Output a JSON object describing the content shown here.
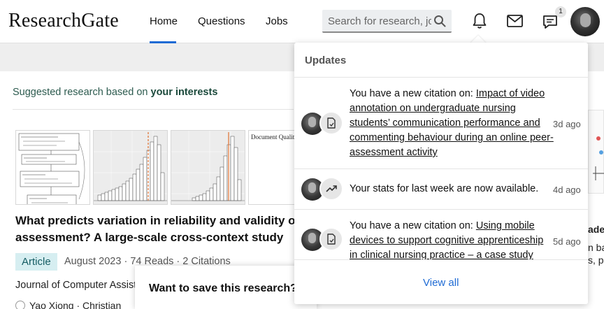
{
  "header": {
    "logo": "ResearchGate",
    "nav": {
      "home": "Home",
      "questions": "Questions",
      "jobs": "Jobs"
    },
    "search_placeholder": "Search for research, jobs",
    "messages_badge": "1",
    "accent_color": "#1f6bd4"
  },
  "main": {
    "suggested_prefix": "Suggested research based on ",
    "suggested_bold": "your interests",
    "thumb_doc_text": "Document Quality",
    "paper": {
      "title_line1": "What predicts variation in reliability and validity of online peer",
      "title_line2": "assessment? A large-scale cross-context study",
      "type": "Article",
      "meta": "August 2023 · 74 Reads · 2 Citations",
      "journal": "Journal of Computer Assisted Learning",
      "authors": "Yao Xiong · Christian"
    },
    "save_prompt": "Want to save this research?",
    "right_partial": {
      "line1": "ader",
      "line2": "n ba",
      "line3": "s, p"
    }
  },
  "updates": {
    "title": "Updates",
    "items": [
      {
        "prefix": "You have a new citation on: ",
        "link": "Impact of video annotation on undergraduate nursing students’ communication performance and commenting behaviour during an online peer-assessment activity",
        "time": "3d ago",
        "icon": "document-icon"
      },
      {
        "prefix": "Your stats for last week are now available.",
        "link": "",
        "time": "4d ago",
        "icon": "trending-up-icon"
      },
      {
        "prefix": "You have a new citation on: ",
        "link": "Using mobile devices to support cognitive apprenticeship in clinical nursing practice – a case study",
        "time": "5d ago",
        "icon": "document-icon"
      }
    ],
    "view_all": "View all"
  }
}
